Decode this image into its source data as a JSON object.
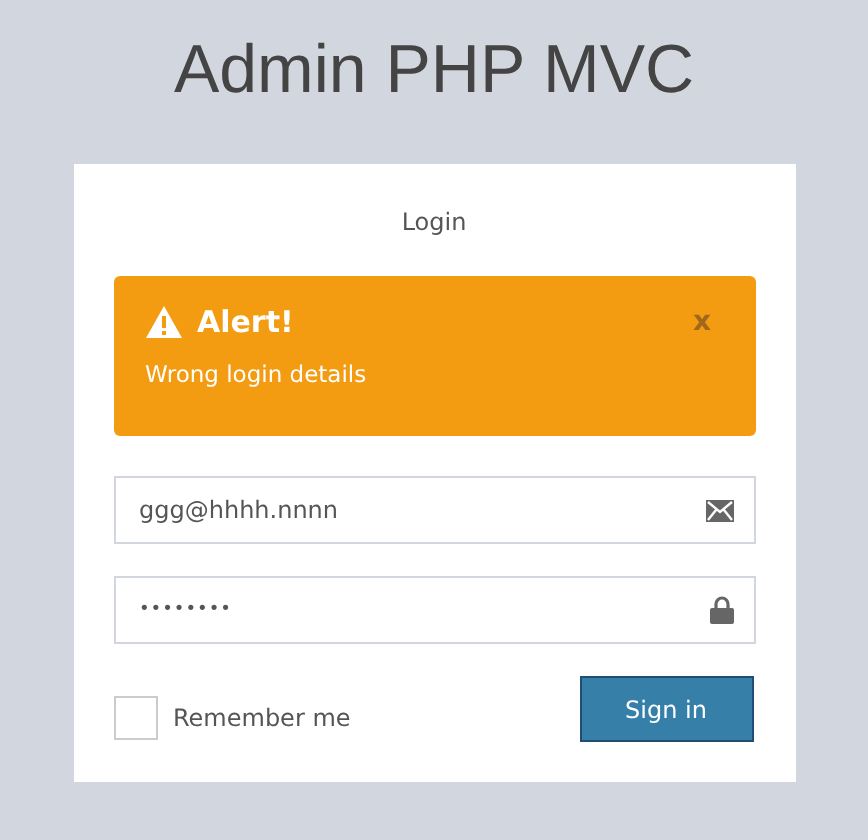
{
  "logo": "Admin PHP MVC",
  "box_title": "Login",
  "alert": {
    "title": "Alert!",
    "message": "Wrong login details",
    "close": "x"
  },
  "email": {
    "value": "ggg@hhhh.nnnn"
  },
  "password": {
    "value": "••••••••"
  },
  "remember": {
    "label": "Remember me",
    "checked": false
  },
  "submit": "Sign in"
}
